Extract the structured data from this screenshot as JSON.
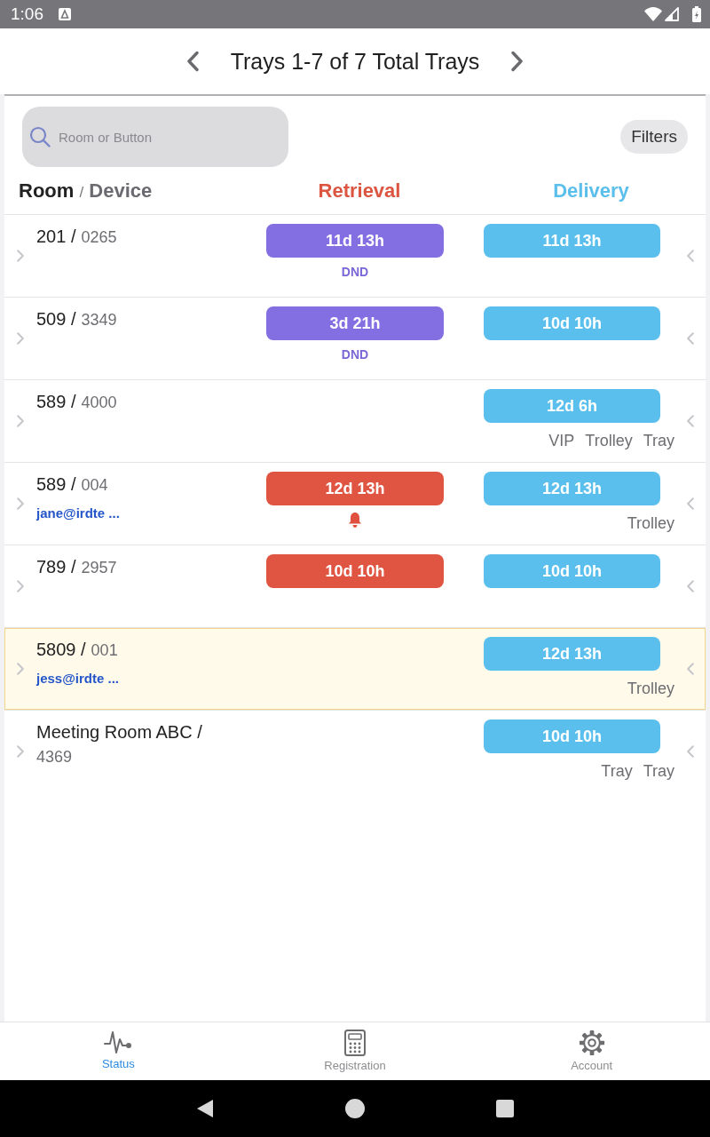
{
  "status_bar": {
    "time": "1:06"
  },
  "header": {
    "title": "Trays 1-7 of 7 Total Trays"
  },
  "search": {
    "placeholder": "Room or Button"
  },
  "filters_button": {
    "label": "Filters"
  },
  "columns": {
    "room": "Room",
    "separator": "/",
    "device": "Device",
    "retrieval": "Retrieval",
    "delivery": "Delivery"
  },
  "rows": [
    {
      "room": "201 /",
      "device": "0265",
      "highlighted": false,
      "retrieval": {
        "kind": "dnd",
        "time": "11d 13h",
        "note": "DND",
        "bell": false
      },
      "delivery": {
        "time": "11d 13h"
      }
    },
    {
      "room": "509 /",
      "device": "3349",
      "highlighted": false,
      "retrieval": {
        "kind": "dnd",
        "time": "3d 21h",
        "note": "DND",
        "bell": false
      },
      "delivery": {
        "time": "10d 10h"
      }
    },
    {
      "room": "589 /",
      "device": "4000",
      "highlighted": false,
      "delivery": {
        "time": "12d 6h",
        "tags": [
          "VIP",
          "Trolley",
          "Tray"
        ]
      }
    },
    {
      "room": "589 /",
      "device": "004",
      "email": "jane@irdte ...",
      "highlighted": false,
      "retrieval": {
        "kind": "alert",
        "time": "12d 13h",
        "bell": true
      },
      "delivery": {
        "time": "12d 13h",
        "tags": [
          "Trolley"
        ]
      }
    },
    {
      "room": "789 /",
      "device": "2957",
      "highlighted": false,
      "retrieval": {
        "kind": "alert",
        "time": "10d 10h",
        "bell": false
      },
      "delivery": {
        "time": "10d 10h"
      }
    },
    {
      "room": "5809 /",
      "device": "001",
      "email": "jess@irdte ...",
      "highlighted": true,
      "delivery": {
        "time": "12d 13h",
        "tags": [
          "Trolley"
        ]
      }
    },
    {
      "room": "Meeting Room ABC /",
      "device": "4369",
      "highlighted": false,
      "delivery": {
        "time": "10d 10h",
        "tags": [
          "Tray",
          "Tray"
        ]
      }
    }
  ],
  "tabs": [
    {
      "label": "Status",
      "selected": true
    },
    {
      "label": "Registration",
      "selected": false
    },
    {
      "label": "Account",
      "selected": false
    }
  ]
}
